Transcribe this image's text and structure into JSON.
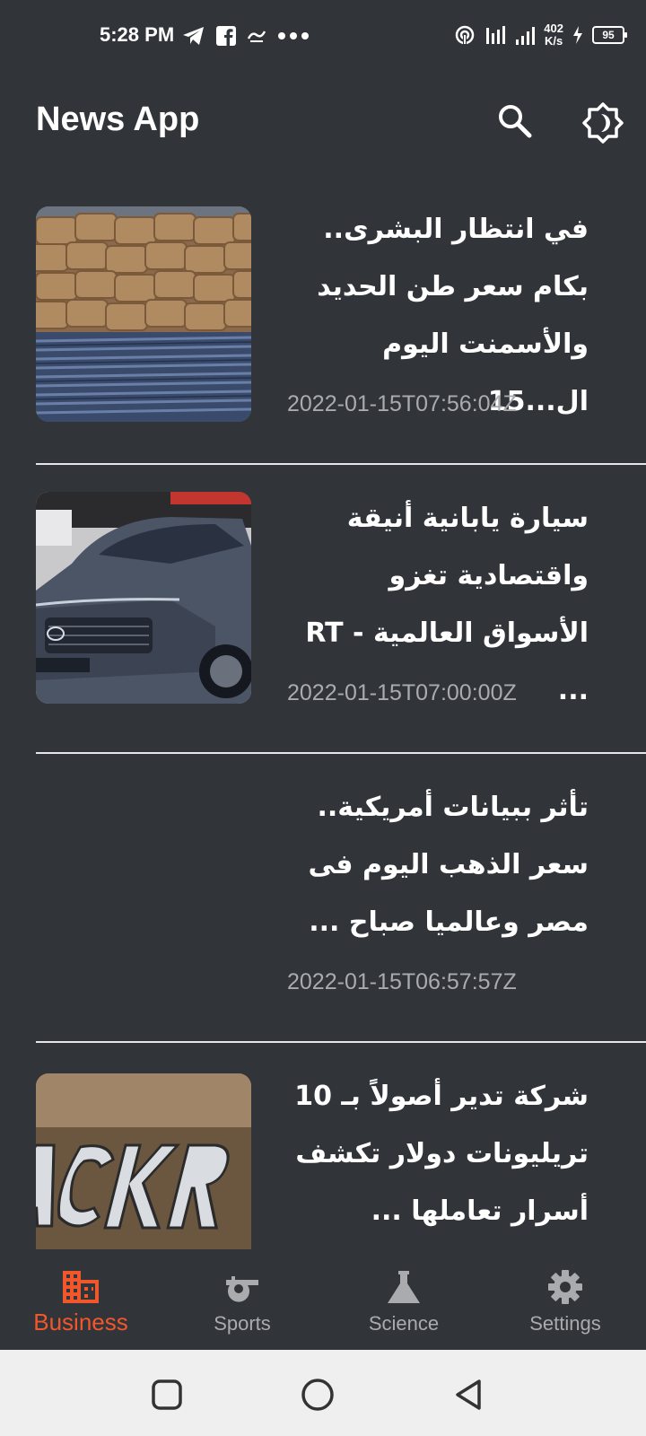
{
  "status_bar": {
    "time": "5:28 PM",
    "left_icons": [
      "telegram-icon",
      "facebook-icon",
      "app-notification-icon",
      "more-dots-icon"
    ],
    "net_speed_value": "402",
    "net_speed_unit": "K/s",
    "battery": "95"
  },
  "app_bar": {
    "title": "News App",
    "icons": [
      "search-icon",
      "brightness-icon"
    ]
  },
  "articles": [
    {
      "headline": "في انتظار البشرى.. بكام سعر طن الحديد والأسمنت اليوم ال...15",
      "timestamp": "2022-01-15T07:56:04Z",
      "image": "cement-bags-and-steel-rebar-photo"
    },
    {
      "headline": "سيارة يابانية أنيقة واقتصادية تغزو الأسواق العالمية - RT ...",
      "timestamp": "2022-01-15T07:00:00Z",
      "image": "honda-hr-v-car-photo"
    },
    {
      "headline": "تأثر ببيانات أمريكية.. سعر الذهب اليوم فى مصر وعالميا صباح ...",
      "timestamp": "2022-01-15T06:57:57Z",
      "image": ""
    },
    {
      "headline": "شركة تدير أصولاً بـ 10 تريليونات دولار تكشف أسرار تعاملها ...",
      "timestamp": "",
      "image": "blackrock-sign-photo"
    }
  ],
  "bottom_nav": {
    "items": [
      {
        "label": "Business",
        "icon": "building-icon",
        "active": true
      },
      {
        "label": "Sports",
        "icon": "whistle-icon",
        "active": false
      },
      {
        "label": "Science",
        "icon": "flask-icon",
        "active": false
      },
      {
        "label": "Settings",
        "icon": "gear-icon",
        "active": false
      }
    ]
  },
  "colors": {
    "background": "#313439",
    "accent": "#f2572b",
    "secondary_text": "#a9abae",
    "system_nav_bg": "#efefef"
  }
}
